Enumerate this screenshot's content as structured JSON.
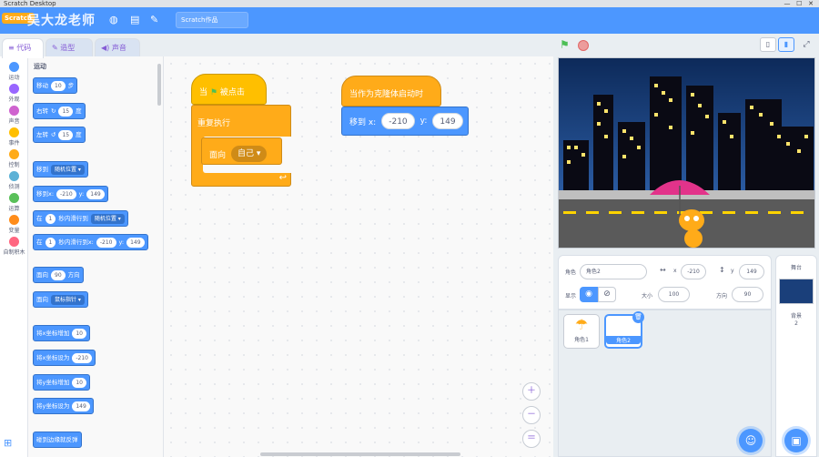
{
  "window": {
    "title": "Scratch Desktop",
    "controls": [
      "—",
      "☐",
      "✕"
    ]
  },
  "menubar": {
    "logo": "Scratch",
    "watermark": "吴大龙老师",
    "project_title": "Scratch作品",
    "icons": [
      "globe-icon",
      "file-icon",
      "edit-icon"
    ]
  },
  "tabs": [
    {
      "label": "代码",
      "icon": "code-icon"
    },
    {
      "label": "造型",
      "icon": "brush-icon"
    },
    {
      "label": "声音",
      "icon": "speaker-icon"
    }
  ],
  "categories": [
    {
      "label": "运动",
      "color": "#4c97ff"
    },
    {
      "label": "外观",
      "color": "#9966ff"
    },
    {
      "label": "声音",
      "color": "#cf63cf"
    },
    {
      "label": "事件",
      "color": "#ffbf00"
    },
    {
      "label": "控制",
      "color": "#ffab19"
    },
    {
      "label": "侦测",
      "color": "#5cb1d6"
    },
    {
      "label": "运算",
      "color": "#59c059"
    },
    {
      "label": "变量",
      "color": "#ff8c1a"
    },
    {
      "label": "自制积木",
      "color": "#ff6680"
    }
  ],
  "palette": {
    "section_title": "运动",
    "move": {
      "pre": "移动",
      "val": "10",
      "post": "步"
    },
    "turn_right": {
      "pre": "右转",
      "icon": "↻",
      "val": "15",
      "post": "度"
    },
    "turn_left": {
      "pre": "左转",
      "icon": "↺",
      "val": "15",
      "post": "度"
    },
    "goto": {
      "pre": "移到",
      "drop": "随机位置"
    },
    "goto_xy": {
      "pre": "移到x:",
      "x": "-210",
      "ylab": "y:",
      "y": "149"
    },
    "glide": {
      "pre": "在",
      "val": "1",
      "mid": "秒内滑行到",
      "drop": "随机位置"
    },
    "glide_xy": {
      "pre": "在",
      "val": "1",
      "mid": "秒内滑行到x:",
      "x": "-210",
      "ylab": "y:",
      "y": "149"
    },
    "point_dir": {
      "pre": "面向",
      "val": "90",
      "post": "方向"
    },
    "point_towards": {
      "pre": "面向",
      "drop": "鼠标指针"
    },
    "change_x": {
      "pre": "将x坐标增加",
      "val": "10"
    },
    "set_x": {
      "pre": "将x坐标设为",
      "val": "-210"
    },
    "change_y": {
      "pre": "将y坐标增加",
      "val": "10"
    },
    "set_y": {
      "pre": "将y坐标设为",
      "val": "149"
    },
    "bounce": {
      "pre": "碰到边缘就反弹"
    }
  },
  "workspace": {
    "script1": {
      "hat_pre": "当",
      "hat_post": "被点击",
      "forever": "重复执行",
      "follow_label": "面向",
      "follow_val": "自己"
    },
    "script2": {
      "hat": "当作为克隆体启动时",
      "goto_label": "移到 x:",
      "x": "-210",
      "ylab": "y:",
      "y": "149"
    }
  },
  "stage_controls": {
    "flag": "green-flag-icon",
    "stop": "stop-icon"
  },
  "sprite_info": {
    "sprite_label": "角色",
    "sprite_name": "角色2",
    "x_label": "x",
    "x": "-210",
    "y_label": "y",
    "y": "149",
    "show_label": "显示",
    "size_label": "大小",
    "size": "100",
    "dir_label": "方向",
    "dir": "90"
  },
  "sprites": [
    {
      "name": "角色1"
    },
    {
      "name": "角色2"
    }
  ],
  "stage_pane": {
    "title": "舞台",
    "backdrop_label": "背景",
    "backdrop_count": "2"
  }
}
